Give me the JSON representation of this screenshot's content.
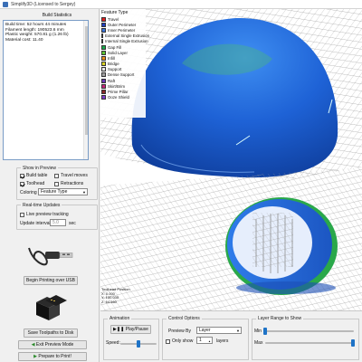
{
  "window": {
    "title": "Simplify3D (Licensed to Sergey)"
  },
  "build_statistics": {
    "group_title": "Build Statistics",
    "lines": [
      "Build time: 52 hours 44 minutes",
      "Filament length: 190523.6 mm",
      "Plastic weight: 570.81 g (1.26 lb)",
      "Material cost: 11.40"
    ]
  },
  "show_in_preview": {
    "group_title": "Show in Preview",
    "build_table": {
      "label": "Build table",
      "checked": true
    },
    "travel_moves": {
      "label": "Travel moves",
      "checked": false
    },
    "toolhead": {
      "label": "Toolhead",
      "checked": true
    },
    "retractions": {
      "label": "Retractions",
      "checked": false
    },
    "coloring_label": "Coloring",
    "coloring_value": "Feature Type"
  },
  "realtime_updates": {
    "group_title": "Real-time Updates",
    "live_tracking": {
      "label": "Live preview tracking",
      "checked": false
    },
    "interval_label": "Update interval",
    "interval_value": "5.0",
    "interval_unit": "sec"
  },
  "buttons": {
    "begin_printing": "Begin Printing over USB",
    "save_toolpaths": "Save Toolpaths to Disk",
    "exit_preview": "Exit Preview Mode",
    "prepare_print": "Prepare to Print!"
  },
  "legend": {
    "title": "Feature Type",
    "items": [
      {
        "label": "Travel",
        "color": "#e02020"
      },
      {
        "label": "Outer Perimeter",
        "color": "#1f3fbf"
      },
      {
        "label": "Inner Perimeter",
        "color": "#3a73d9"
      },
      {
        "label": "External Single Extrusion",
        "color": "#1e90e6"
      },
      {
        "label": "Internal Single Extrusion",
        "color": "#19b7a6"
      },
      {
        "label": "Gap Fill",
        "color": "#1aa84a"
      },
      {
        "label": "Solid Layer",
        "color": "#5cc436"
      },
      {
        "label": "Infill",
        "color": "#e58a1a"
      },
      {
        "label": "Bridge",
        "color": "#d9d326"
      },
      {
        "label": "Support",
        "color": "#e6e6e6"
      },
      {
        "label": "Dense Support",
        "color": "#a0a0a0"
      },
      {
        "label": "Raft",
        "color": "#6a3ab5"
      },
      {
        "label": "Skirt/Brim",
        "color": "#c5257a"
      },
      {
        "label": "Prime Pillar",
        "color": "#8a2a2a"
      },
      {
        "label": "Ooze Shield",
        "color": "#7d3cc8"
      }
    ]
  },
  "toolhead_position": {
    "title": "Toolhead Position",
    "x": "X: 0.000",
    "y": "Y: 130.035",
    "z": "Z: 64.560"
  },
  "animation": {
    "group_title": "Animation",
    "play_label": "Play/Pause",
    "speed_label": "Speed:"
  },
  "control_options": {
    "group_title": "Control Options",
    "preview_by_label": "Preview By",
    "preview_by_value": "Layer",
    "only_show": {
      "label": "Only show",
      "checked": false
    },
    "layers_value": "1",
    "layers_label": "layers"
  },
  "layer_range": {
    "group_title": "Layer Range to Show",
    "min_label": "Min",
    "max_label": "Max"
  },
  "colors": {
    "model_blue": "#1e62d6",
    "grid_line": "#9a9a9a",
    "skirt_green": "#2aa84a",
    "accent": "#1e73c7"
  }
}
